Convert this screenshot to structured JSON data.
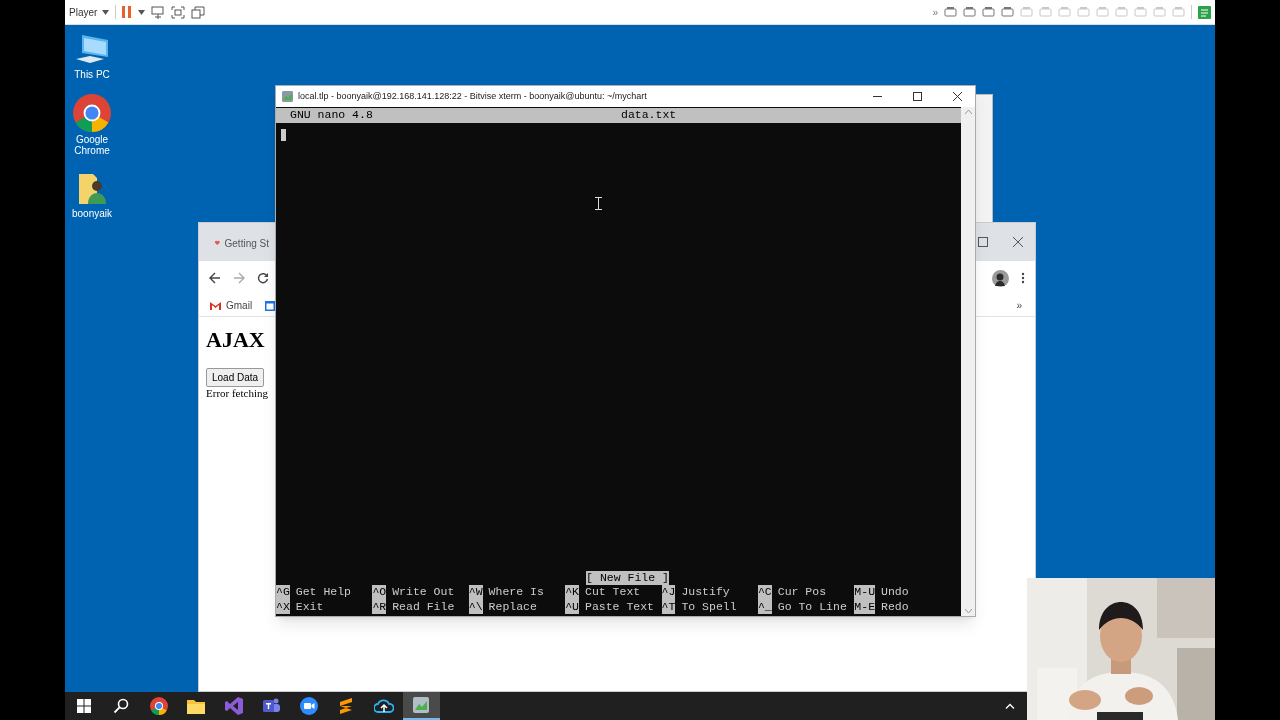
{
  "vm_toolbar": {
    "menu": "Player",
    "more": "»"
  },
  "desktop_icons": [
    {
      "label": "This PC"
    },
    {
      "label": "Google Chrome"
    },
    {
      "label": "boonyaik"
    }
  ],
  "browser": {
    "tab_title": "Getting St",
    "bookmark": "Gmail",
    "more": "»",
    "heading": "AJAX",
    "button": "Load Data",
    "message": "Error fetching"
  },
  "terminal": {
    "title": "local.tlp - boonyaik@192.168.141.128:22 - Bitvise xterm - boonyaik@ubuntu: ~/mychart",
    "app": "GNU nano 4.8",
    "file": "data.txt",
    "status": "[ New File ]",
    "shortcuts": [
      {
        "key": "^G",
        "label": "Get Help"
      },
      {
        "key": "^O",
        "label": "Write Out"
      },
      {
        "key": "^W",
        "label": "Where Is"
      },
      {
        "key": "^K",
        "label": "Cut Text"
      },
      {
        "key": "^J",
        "label": "Justify"
      },
      {
        "key": "^C",
        "label": "Cur Pos"
      },
      {
        "key": "M-U",
        "label": "Undo"
      },
      {
        "key": "^X",
        "label": "Exit"
      },
      {
        "key": "^R",
        "label": "Read File"
      },
      {
        "key": "^\\",
        "label": "Replace"
      },
      {
        "key": "^U",
        "label": "Paste Text"
      },
      {
        "key": "^T",
        "label": "To Spell"
      },
      {
        "key": "^_",
        "label": "Go To Line"
      },
      {
        "key": "M-E",
        "label": "Redo"
      }
    ]
  },
  "taskbar": {
    "items": [
      {
        "selected": false
      },
      {
        "selected": false
      },
      {
        "selected": false
      },
      {
        "selected": false
      },
      {
        "selected": false
      },
      {
        "selected": false
      },
      {
        "selected": false
      },
      {
        "selected": false
      },
      {
        "selected": false
      },
      {
        "selected": true
      }
    ]
  }
}
